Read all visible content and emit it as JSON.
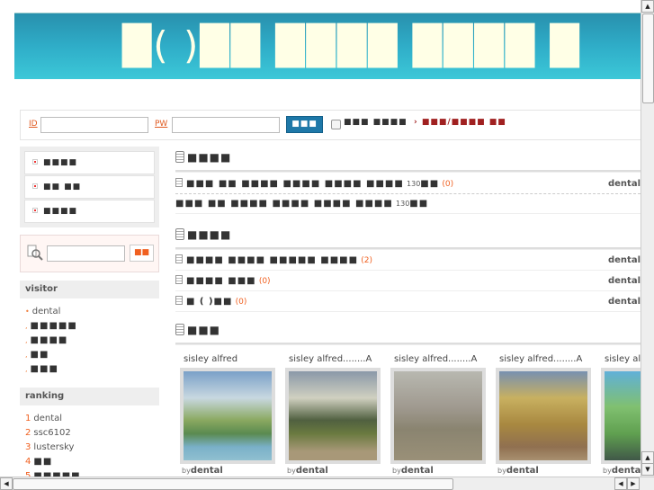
{
  "banner": {
    "title": "█(  )██ ████ ████ █"
  },
  "login": {
    "id_label": "ID",
    "pw_label": "PW",
    "id_value": "",
    "pw_value": "",
    "submit_label": "■■■",
    "remember_label": "■■■ ■■■■",
    "join_links": "› ■■■/■■■■ ■■"
  },
  "menu": {
    "items": [
      {
        "label": "■■■■"
      },
      {
        "label": "■■ ■■"
      },
      {
        "label": "■■■■"
      }
    ]
  },
  "search": {
    "button_label": "■■",
    "value": ""
  },
  "visitor": {
    "title": "visitor",
    "items": [
      "dental",
      "■■■■■",
      "■■■■",
      "■■",
      "■■■"
    ]
  },
  "ranking": {
    "title": "ranking",
    "items": [
      {
        "rank": "1",
        "name": "dental"
      },
      {
        "rank": "2",
        "name": "ssc6102"
      },
      {
        "rank": "3",
        "name": "lustersky"
      },
      {
        "rank": "4",
        "name": "■■"
      },
      {
        "rank": "5",
        "name": "■■■■■"
      }
    ]
  },
  "sections": [
    {
      "title": "■■■■",
      "rows": [
        {
          "text": "■■■ ■■ ■■■■ ■■■■ ■■■■ ■■■■",
          "num": "130",
          "suffix": "■■",
          "count": "(0)",
          "author": "dental"
        },
        {
          "text": "■■■ ■■ ■■■■ ■■■■ ■■■■ ■■■■",
          "num": "130",
          "suffix": "■■"
        }
      ]
    },
    {
      "title": "■■■■",
      "rows": [
        {
          "text": "■■■■ ■■■■ ■■■■■ ■■■■",
          "count": "(2)",
          "author": "dental"
        },
        {
          "text": "■■■■ ■■■",
          "count": "(0)",
          "author": "dental"
        },
        {
          "text": "■ ( )■■",
          "count": "(0)",
          "author": "dental"
        }
      ]
    },
    {
      "title": "■■■"
    }
  ],
  "gallery": [
    {
      "title": "sisley alfred",
      "by": "by",
      "author": "dental"
    },
    {
      "title": "sisley alfred........A",
      "by": "by",
      "author": "dental"
    },
    {
      "title": "sisley alfred........A",
      "by": "by",
      "author": "dental"
    },
    {
      "title": "sisley alfred........A",
      "by": "by",
      "author": "dental"
    },
    {
      "title": "sisley alfred........A",
      "by": "by",
      "author": "dental"
    }
  ]
}
